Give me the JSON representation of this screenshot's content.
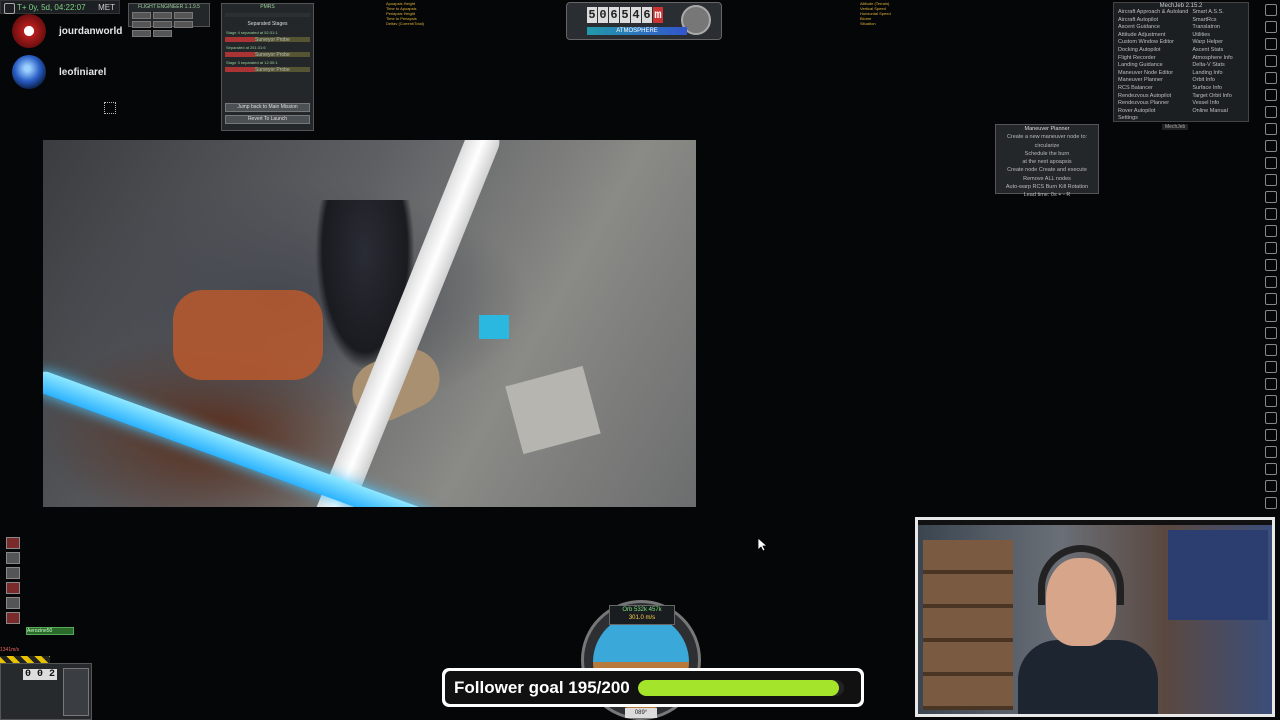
{
  "met": {
    "time": "T+ 0y, 5d, 04:22:07",
    "label": "MET"
  },
  "chat_users": [
    {
      "name": "jourdanworld",
      "color": "#c02020"
    },
    {
      "name": "leofiniarel",
      "color": "#2a5fc6"
    }
  ],
  "flight_engineer": {
    "title": "FLIGHT ENGINEER 1.1.9.5"
  },
  "pmrs": {
    "title": "PMRS",
    "separated": "Separated Stages",
    "stages": [
      "Stage 4 separated at 52:31:1",
      "Surveyor Probe",
      "Separated at 251:31:6",
      "Surveyor Probe",
      "Stage 3 separated at 12:30:1",
      "Surveyor Probe"
    ],
    "btn_main": "Jump back to Main Mission",
    "btn_revert": "Revert To Launch"
  },
  "orbit_info": {
    "left": [
      "Apoapsis Height",
      "Time to Apoapsis",
      "Periapsis Height",
      "Time to Periapsis",
      "Deltav (Current/Total)"
    ],
    "right": [
      "Altitude (Terrain)",
      "Vertical Speed",
      "Horizontal Speed",
      "Biome",
      "Situation"
    ]
  },
  "altimeter": {
    "digits": [
      "5",
      "0",
      "6",
      "5",
      "4",
      "6"
    ],
    "unit": "m",
    "atmosphere": "ATMOSPHERE"
  },
  "mechjeb": {
    "title": "MechJeb 2.15.2",
    "col1": [
      "Aircraft Approach & Autoland",
      "Aircraft Autopilot",
      "Ascent Guidance",
      "Attitude Adjustment",
      "Custom Window Editor",
      "Docking Autopilot",
      "Flight Recorder",
      "Landing Guidance",
      "Maneuver Node Editor",
      "Maneuver Planner",
      "RCS Balancer",
      "Rendezvous Autopilot",
      "Rendezvous Planner",
      "Rover Autopilot",
      "Settings"
    ],
    "col2": [
      "Smart A.S.S.",
      "SmartRcs",
      "Translatron",
      "Utilities",
      "Warp Helper",
      "Ascent Stats",
      "Atmosphere Info",
      "Delta-V Stats",
      "Landing Info",
      "Orbit Info",
      "Surface Info",
      "Target Orbit Info",
      "Vessel Info",
      "Online Manual"
    ],
    "tag": "MechJeb"
  },
  "maneuver_planner": {
    "title": "Maneuver Planner",
    "line1": "Create a new maneuver node to:",
    "line2": "circularize",
    "line3": "Schedule the burn",
    "line4": "at the next apoapsis",
    "line5": "Create node    Create and execute",
    "line6": "Remove ALL nodes",
    "line7": "Auto-warp  RCS Burn  Kill Rotation",
    "line8": "Lead time: 0s + - R"
  },
  "left_panel": {
    "speed": "1341m/s",
    "stage_num": "0 0 2",
    "fuel": "Aerozine50"
  },
  "navball": {
    "mode": "Orb 532k 457k",
    "speed": "301.0 m/s",
    "heading": "089°"
  },
  "follower_goal": {
    "label": "Follower goal 195/200",
    "current": 195,
    "target": 200,
    "fraction": 0.975
  }
}
